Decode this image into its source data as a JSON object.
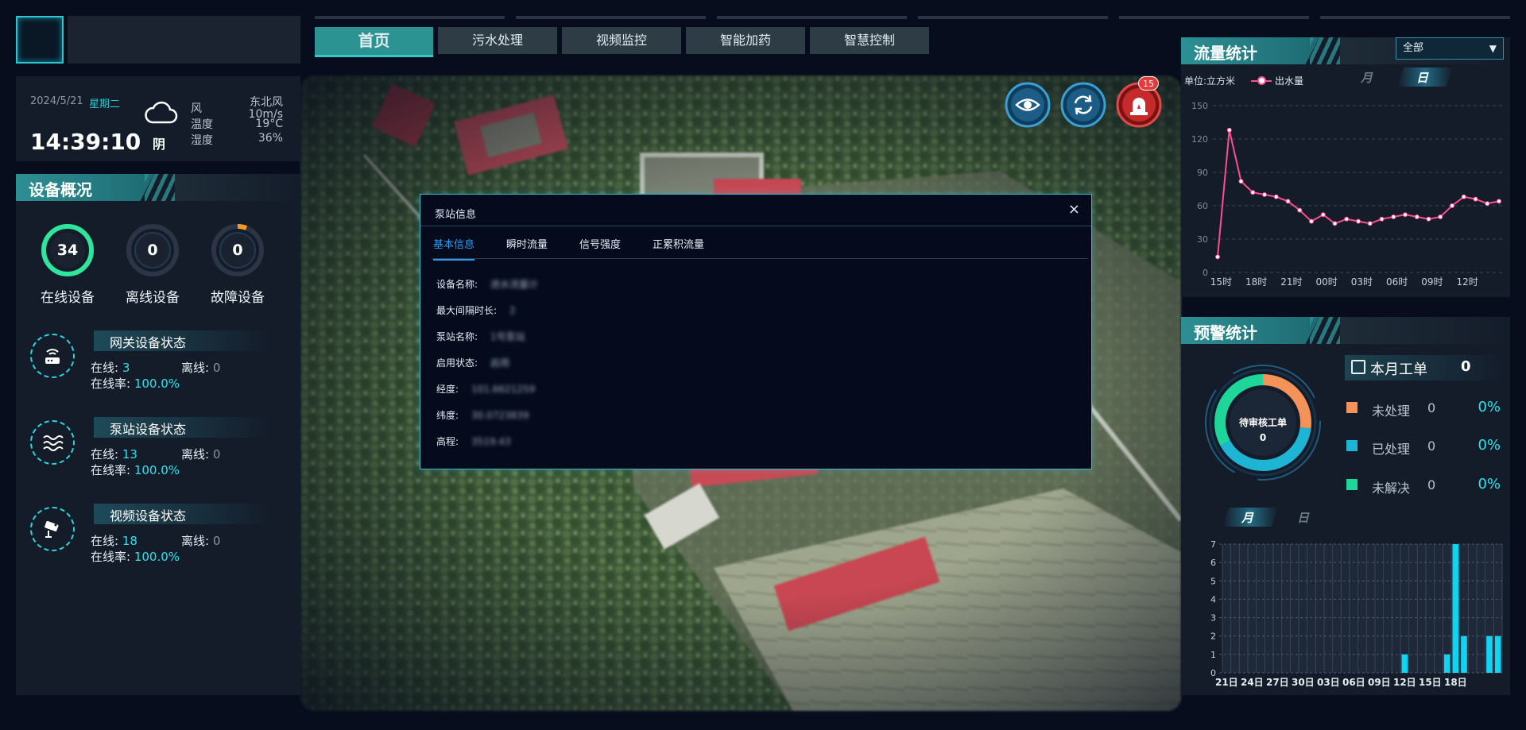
{
  "nav": {
    "tabs": [
      {
        "label": "首页",
        "active": true
      },
      {
        "label": "污水处理"
      },
      {
        "label": "视频监控"
      },
      {
        "label": "智能加药"
      },
      {
        "label": "智慧控制"
      }
    ]
  },
  "weather": {
    "date": "2024/5/21",
    "weekday": "星期二",
    "time": "14:39:10",
    "condition": "阴",
    "wind_label": "风",
    "wind_dir": "东北风",
    "wind_speed": "10m/s",
    "temp_label": "温度",
    "temp_value": "19°C",
    "humidity_label": "湿度",
    "humidity_value": "36%",
    "icon": "cloud-icon"
  },
  "overview": {
    "title": "设备概况",
    "gauges": [
      {
        "label": "在线设备",
        "value": "34",
        "fraction": 1.0,
        "color": "#2ee59d"
      },
      {
        "label": "离线设备",
        "value": "0",
        "fraction": 0.0,
        "color": "#2f9ef5"
      },
      {
        "label": "故障设备",
        "value": "0",
        "fraction": 0.06,
        "color": "#f59a23"
      }
    ],
    "stats": [
      {
        "title": "网关设备状态",
        "icon": "router-icon",
        "online_label": "在线:",
        "online": "3",
        "offline_label": "离线:",
        "offline": "0",
        "rate_label": "在线率:",
        "rate": "100.0%"
      },
      {
        "title": "泵站设备状态",
        "icon": "water-wave-icon",
        "online_label": "在线:",
        "online": "13",
        "offline_label": "离线:",
        "offline": "0",
        "rate_label": "在线率:",
        "rate": "100.0%"
      },
      {
        "title": "视频设备状态",
        "icon": "camera-icon",
        "online_label": "在线:",
        "online": "18",
        "offline_label": "离线:",
        "offline": "0",
        "rate_label": "在线率:",
        "rate": "100.0%"
      }
    ]
  },
  "map_buttons": {
    "badge_count": "15",
    "icons": [
      "eye-icon",
      "refresh-icon",
      "alarm-icon"
    ]
  },
  "modal": {
    "title": "泵站信息",
    "close": "×",
    "tabs": [
      "基本信息",
      "瞬时流量",
      "信号强度",
      "正累积流量"
    ],
    "rows": [
      {
        "label": "设备名称:",
        "value": "进水流量计"
      },
      {
        "label": "最大间隔时长:",
        "value": "2"
      },
      {
        "label": "泵站名称:",
        "value": "1号泵站"
      },
      {
        "label": "启用状态:",
        "value": "启用"
      },
      {
        "label": "经度:",
        "value": "101.6621259"
      },
      {
        "label": "纬度:",
        "value": "30.0723839"
      },
      {
        "label": "高程:",
        "value": "3519.43"
      }
    ]
  },
  "flow": {
    "title": "流量统计",
    "select_value": "全部",
    "unit": "单位:立方米",
    "legend": "出水量",
    "toggle_month": "月",
    "toggle_day": "日",
    "active_toggle": "day"
  },
  "warning": {
    "title": "预警统计",
    "work_order_label": "本月工单",
    "work_order_count": "0",
    "donut_label": "待审核工单",
    "donut_value": "0",
    "legend": [
      {
        "name": "未处理",
        "count": "0",
        "pct": "0%",
        "color": "#f3935a"
      },
      {
        "name": "已处理",
        "count": "0",
        "pct": "0%",
        "color": "#1eb4d4"
      },
      {
        "name": "未解决",
        "count": "0",
        "pct": "0%",
        "color": "#1fd69a"
      }
    ],
    "toggle_month": "月",
    "toggle_day": "日",
    "active_toggle": "month"
  },
  "chart_data": [
    {
      "type": "line",
      "title": "",
      "xlabel": "",
      "ylabel": "单位:立方米",
      "ylim": [
        0,
        150
      ],
      "yticks": [
        0,
        30,
        60,
        90,
        120,
        150
      ],
      "x_tick_labels": [
        "15时",
        "18时",
        "21时",
        "00时",
        "03时",
        "06时",
        "09时",
        "12时"
      ],
      "grid": true,
      "series": [
        {
          "name": "出水量",
          "color": "#ff4d8d",
          "values": [
            14,
            128,
            82,
            72,
            70,
            68,
            64,
            56,
            46,
            52,
            44,
            48,
            46,
            44,
            48,
            50,
            52,
            50,
            48,
            50,
            60,
            68,
            66,
            62,
            64
          ]
        }
      ]
    },
    {
      "type": "bar",
      "title": "",
      "xlabel": "",
      "ylabel": "",
      "ylim": [
        0,
        7
      ],
      "yticks": [
        0,
        1,
        2,
        3,
        4,
        5,
        6,
        7
      ],
      "x_tick_labels": [
        "21日",
        "24日",
        "27日",
        "30日",
        "03日",
        "06日",
        "09日",
        "12日",
        "15日",
        "18日"
      ],
      "grid": true,
      "series": [
        {
          "name": "",
          "color": "#12d4f0",
          "values": [
            0,
            0,
            0,
            0,
            0,
            0,
            0,
            0,
            0,
            0,
            0,
            0,
            0,
            0,
            0,
            0,
            0,
            0,
            0,
            0,
            0,
            1,
            0,
            0,
            0,
            0,
            1,
            7,
            2,
            0,
            0,
            2,
            2
          ]
        }
      ]
    }
  ]
}
